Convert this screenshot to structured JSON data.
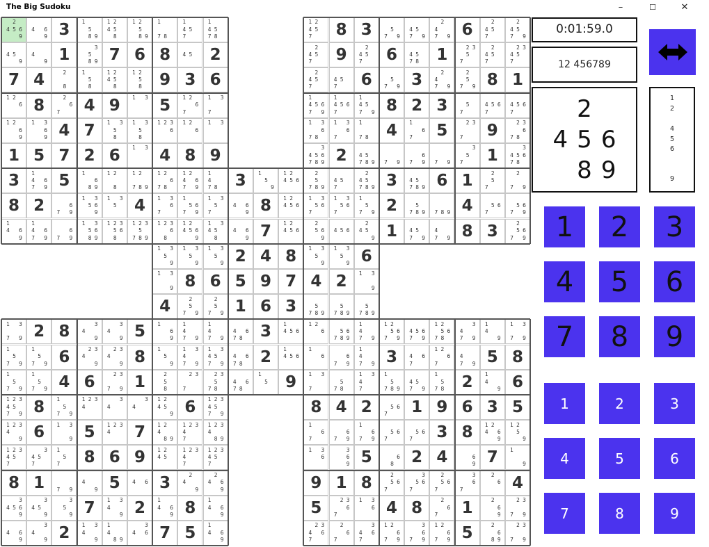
{
  "app": {
    "title": "The Big Sudoku",
    "window_buttons": [
      "–",
      "☐",
      "✕"
    ]
  },
  "status": {
    "timer": "0:01:59.0",
    "cell_value_digits": "12  456789",
    "selected_cell_candidates": [
      "",
      "2",
      "",
      "4",
      "5",
      "6",
      "",
      "8",
      "9"
    ],
    "candidate_stack": [
      "1",
      "2",
      "",
      "4",
      "5",
      "6",
      "",
      "",
      "9"
    ]
  },
  "keypad": {
    "value_keys": [
      "1",
      "2",
      "3",
      "4",
      "5",
      "6",
      "7",
      "8",
      "9"
    ],
    "pencil_keys": [
      "1",
      "2",
      "3",
      "4",
      "5",
      "6",
      "7",
      "8",
      "9"
    ]
  },
  "colors": {
    "accent": "#4b33ee",
    "selected_cell": "#c5ecc5"
  },
  "icons": {
    "swap": "left-right-arrow-icon"
  },
  "board": {
    "note": "Samurai sudoku: 5 overlapping 9x9 grids; rows 0-20, cols 0-20. Each row lists 21 cells; null = outside grid; number string = given; array of 9 = pencil candidates.",
    "rows": [
      [
        "2 456 9",
        "46 9",
        "3",
        "1 5 89",
        "12 45 8",
        "12 5 89",
        "1 7 8",
        "1 45 7",
        "1 45 78",
        null,
        null,
        null,
        "12 45 7",
        "8",
        "3",
        "5 7 9",
        "45 7 9",
        "2 4 7 9",
        "6",
        "2 45 7",
        "2 45 79"
      ],
      [
        "45 9",
        "4 9",
        "1",
        "3 5 89",
        "7",
        "6",
        "8",
        "45",
        "2",
        null,
        null,
        null,
        "2 45 7",
        "9",
        "2 45 7",
        "6",
        "45 78",
        "1",
        "23 5 7",
        "2 45 7",
        "23 45 7"
      ],
      [
        "7",
        "4",
        "2 8",
        "1 5 8",
        "12 45 8",
        "12 5 8",
        "9",
        "3",
        "6",
        null,
        null,
        null,
        "2 45 7",
        "45 7",
        "6",
        "5 7 9",
        "3",
        "2 4 7 9",
        "2 5 7 9",
        "8",
        "1"
      ],
      [
        "12 6",
        "8",
        "2 6 7",
        "4",
        "9",
        "1 3",
        "5",
        "12 6 7",
        "1 3 7",
        null,
        null,
        null,
        "1 456 79",
        "1 456 7",
        "1 45 7 9",
        "8",
        "2",
        "3",
        "5 7",
        "456 7",
        "456 7"
      ],
      [
        "12 6 9",
        "1 3 6 9",
        "4",
        "7",
        "1 3 5 8",
        "1 3 5 8",
        "123 6",
        "12 6",
        "1 3",
        null,
        null,
        null,
        "1 3 6 78",
        "1 3 6 7",
        "1 78",
        "4",
        "1 6 7",
        "5",
        "23 7",
        "9",
        "23 6 78"
      ],
      [
        "1",
        "5",
        "7",
        "2",
        "6",
        "1 3",
        "4",
        "8",
        "9",
        null,
        null,
        null,
        "3 456 789",
        "2",
        "45 789",
        "7 9",
        "6 7 9",
        "7 9",
        "3 5 7",
        "1",
        "3 456 78"
      ],
      [
        "3",
        "1 46 79",
        "5",
        "1 6 89",
        "12 8",
        "12 789",
        "12 6 78",
        "12 4 6 79",
        "1 4 78",
        "3",
        "1 5 9",
        "12 456",
        "2 5 789",
        "45 7",
        "2 45 789",
        "3",
        "45 789",
        "6",
        "1",
        "2 5 7",
        "2 7 9"
      ],
      [
        "8",
        "2",
        "6 7 9",
        "1 3 56 9",
        "1 3 5",
        "4",
        "1 3 6 7",
        "1 56 7 9",
        "1 3 5 7",
        "46 9",
        "8",
        "12 456",
        "1 3 56 7",
        "1 3 56 7",
        "1 5 7 9",
        "2",
        "5 789",
        "789",
        "4",
        "56 7",
        "56 79"
      ],
      [
        "1 4 6 9",
        "1 46 79",
        "6 7 9",
        "1 3 56 89",
        "123 56 8",
        "123 5 789",
        "123 6 8",
        "12 456 9",
        "1 3 45 8",
        "46 9",
        "7",
        "12 456",
        "2 56 9",
        "456",
        "2 45 9",
        "1",
        "45 7 9",
        "4 7 9",
        "8",
        "3",
        "2 56 79"
      ],
      [
        null,
        null,
        null,
        null,
        null,
        null,
        "1 3 5 9",
        "1 3 5 9",
        "1 3 5 9",
        "2",
        "4",
        "8",
        "1 3 5 9",
        "1 3 5 9",
        "6",
        null,
        null,
        null,
        null,
        null,
        null
      ],
      [
        null,
        null,
        null,
        null,
        null,
        null,
        "1 3 9",
        "8",
        "6",
        "5",
        "9",
        "7",
        "4",
        "2",
        "1 3 9",
        null,
        null,
        null,
        null,
        null,
        null
      ],
      [
        null,
        null,
        null,
        null,
        null,
        null,
        "4",
        "2 5 79",
        "2 5 79",
        "1",
        "6",
        "3",
        "5 789",
        "5 789",
        "5 789",
        null,
        null,
        null,
        null,
        null,
        null
      ],
      [
        "1 3 7 9",
        "2",
        "8",
        "4 3 9",
        "4 3 9",
        "5",
        "1 6 9",
        "1 4 79",
        "1 4 79",
        "46 78",
        "3",
        "1 456",
        "12 6",
        "56 789",
        "1 4 7 9",
        "12 56 79",
        "456 7 9",
        "12 56 78",
        "4 3 7 9",
        "1 4 9",
        "1 3 7 9"
      ],
      [
        "1 5 79",
        "1 5 79",
        "6",
        "4 23 9",
        "4 23 9",
        "8",
        "1 5 9",
        "1 3 4 79",
        "1 3 45 79",
        "46 78",
        "2",
        "1 456",
        "1 6",
        "6 7 9",
        "1 4 79",
        "3",
        "4 6 7",
        "12 6 7",
        "4 7 9",
        "5",
        "8"
      ],
      [
        "1 5 79",
        "1 5 79",
        "4",
        "6",
        "23 7 9",
        "1",
        "2 5 8",
        "23 7",
        "23 5 78",
        "46 78",
        "1 5",
        "9",
        "1 3 7",
        "5 78",
        "1 3 47",
        "1 5 789",
        "45 79",
        "1 5 78",
        "2",
        "1 4 9",
        "6"
      ],
      [
        "123 45 79",
        "8",
        "1 5 79",
        "123 4",
        "4 3",
        "4 3",
        "12 45 9",
        "6",
        "123 45 79",
        null,
        null,
        null,
        "8",
        "4",
        "2",
        "56 7",
        "1",
        "9",
        "6",
        "3",
        "5"
      ],
      [
        "123 4 9",
        "6",
        "1 3 9",
        "5",
        "123 4",
        "7",
        "12 4 89",
        "123 4 7",
        "123 4 89",
        null,
        null,
        null,
        "1 6 7",
        "6 7 9",
        "1 6 79",
        "56 7",
        "56 7",
        "3",
        "8",
        "12 4 6 9",
        "12 5 9"
      ],
      [
        "123 45 7",
        "45 3 7",
        "1 5 7",
        "8",
        "6",
        "9",
        "12 45",
        "123 4 7",
        "123 45 7",
        null,
        null,
        null,
        "1 3 6",
        "3 6 9",
        "5",
        "6 8",
        "2",
        "4",
        "6 9",
        "7",
        "1 9"
      ],
      [
        "8",
        "1",
        "7 9",
        "4 9",
        "5",
        "4 6",
        "3",
        "4 2 9",
        "4 2 6 9",
        null,
        null,
        null,
        "9",
        "1",
        "8",
        "2 56 7",
        "3 56 7",
        "2 56 7",
        "3 6 7",
        "2 6",
        "4"
      ],
      [
        "456 3 9",
        "45 3 9",
        "5 3 9",
        "7",
        "1 4 3 9",
        "2",
        "1 4 6 9",
        "8",
        "1 4 6 9",
        null,
        null,
        null,
        "5",
        "23 6 7",
        "1 3 6",
        "4",
        "8",
        "2 6 7",
        "1",
        "2 6 9",
        "23 79"
      ],
      [
        "4 6 9",
        "4 3 9",
        "2",
        "1 4 3 9",
        "1 4 89",
        "4 3 6",
        "7",
        "5",
        "1 4 6 9",
        null,
        null,
        null,
        "23 4 6 7",
        "2 6 7",
        "4 3 6 7",
        "12 6 79",
        "3 6 79",
        "12 6 79",
        "5",
        "2 6 89",
        "23 79"
      ]
    ],
    "selected": [
      0,
      0
    ]
  }
}
